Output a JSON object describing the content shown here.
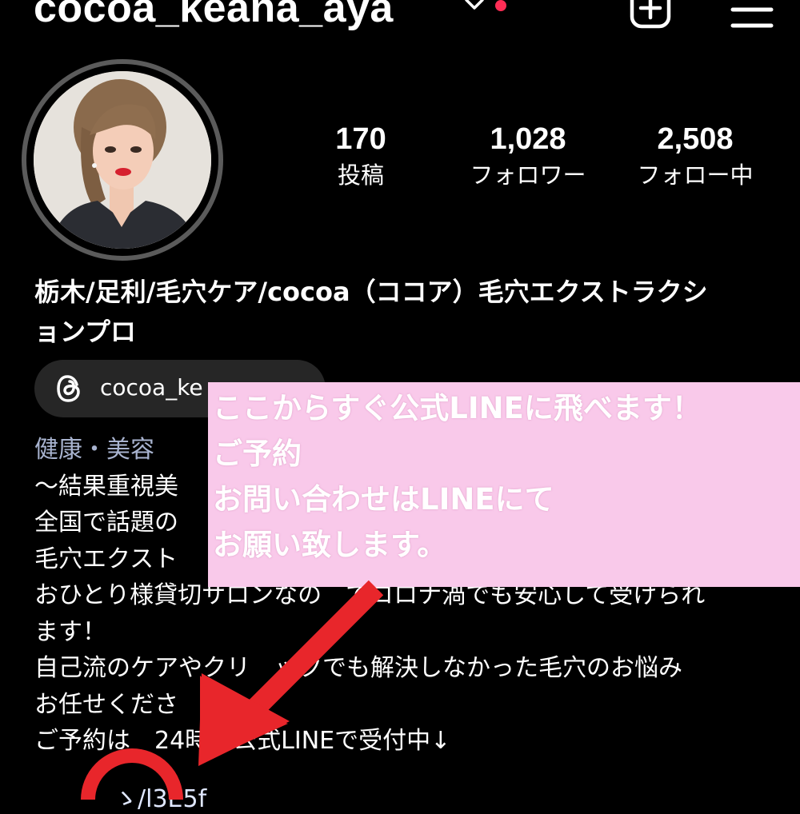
{
  "header": {
    "username": "cocoa_keana_aya",
    "icons": [
      "chevron-down-icon",
      "notification-dot",
      "create-post-icon",
      "menu-icon"
    ]
  },
  "stats": {
    "posts": {
      "value": "170",
      "label": "投稿"
    },
    "followers": {
      "value": "1,028",
      "label": "フォロワー"
    },
    "following": {
      "value": "2,508",
      "label": "フォロー中"
    }
  },
  "profile": {
    "display_name_line1": "栃木/足利/毛穴ケア/cocoa（ココア）毛穴エクストラクシ",
    "display_name_line2": "ョンプロ",
    "threads_handle": "cocoa_ke"
  },
  "bio": {
    "category": "健康・美容",
    "lines": [
      "〜結果重視美",
      "全国で話題の",
      "毛穴エクスト",
      "おひとり様貸切サロンなの　でコロナ渦でも安心して受けられ",
      "ます！",
      "自己流のケアやクリ　ックでも解決しなかった毛穴のお悩み",
      "お任せくださ",
      "ご予約は　24時間公式LINEで受付中↓"
    ],
    "link": "　　　ゝ/l3E5f"
  },
  "overlay": {
    "lines": [
      "ここからすぐ公式LINEに飛べます！",
      "ご予約",
      "お問い合わせはLINEにて",
      "お願い致します。"
    ]
  },
  "colors": {
    "background": "#000000",
    "overlay_bg": "#f9c9ea",
    "annotation_red": "#e8262b",
    "notification": "#ff2d55",
    "chip_bg": "#262626",
    "category_text": "#a8b3cf"
  }
}
